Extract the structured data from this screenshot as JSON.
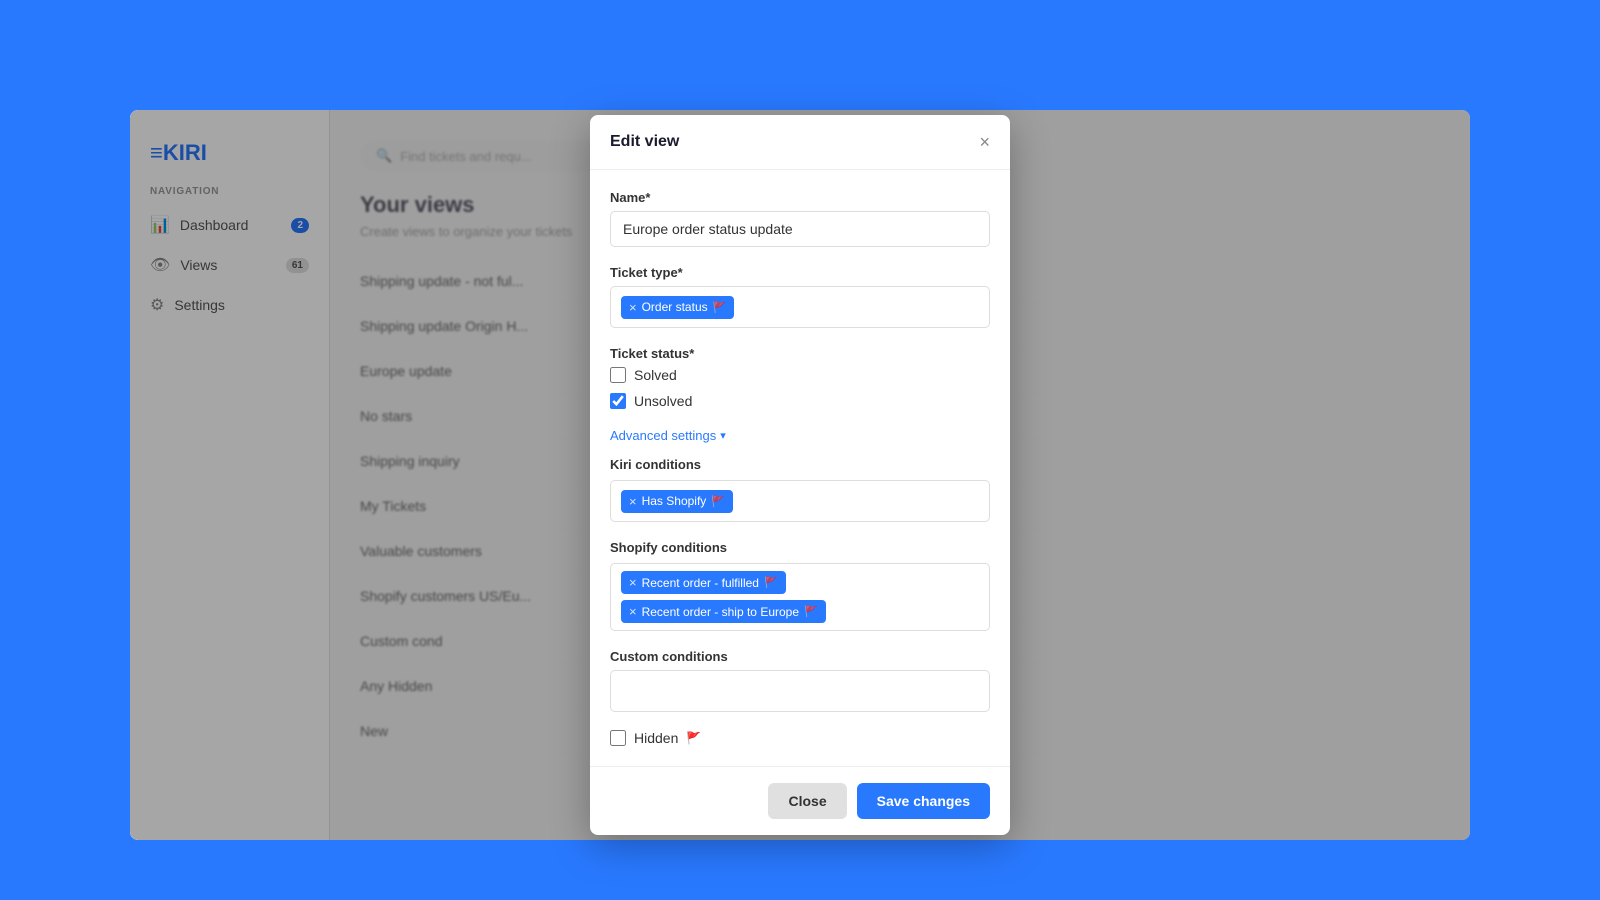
{
  "app": {
    "logo": "≡KIRI",
    "background_color": "#2979FF"
  },
  "sidebar": {
    "nav_label": "Navigation",
    "items": [
      {
        "id": "dashboard",
        "label": "Dashboard",
        "icon": "📊",
        "badge": "2",
        "badge_type": "blue"
      },
      {
        "id": "views",
        "label": "Views",
        "icon": "👁",
        "badge": "61",
        "badge_type": "gray"
      },
      {
        "id": "settings",
        "label": "Settings",
        "icon": "⚙",
        "badge": null
      }
    ]
  },
  "main": {
    "title": "Your views",
    "subtitle": "Create views to organize your tickets",
    "search_placeholder": "Find tickets and requ...",
    "views": [
      "Shipping update - not ful...",
      "Shipping update Origin H...",
      "Europe update",
      "No stars",
      "Shipping inquiry",
      "My Tickets",
      "Valuable customers",
      "Shopify customers US/Eu...",
      "Custom cond",
      "Any  Hidden",
      "New"
    ]
  },
  "modal": {
    "title": "Edit view",
    "close_label": "×",
    "name_label": "Name*",
    "name_value": "Europe order status update",
    "ticket_type_label": "Ticket type*",
    "ticket_type_tag": "Order status",
    "ticket_status_label": "Ticket status*",
    "solved_label": "Solved",
    "solved_checked": false,
    "unsolved_label": "Unsolved",
    "unsolved_checked": true,
    "advanced_settings_label": "Advanced settings",
    "advanced_settings_open": true,
    "kiri_conditions_label": "Kiri conditions",
    "kiri_tag": "Has Shopify",
    "shopify_conditions_label": "Shopify conditions",
    "shopify_tag1": "Recent order - fulfilled",
    "shopify_tag2": "Recent order - ship to Europe",
    "custom_conditions_label": "Custom conditions",
    "custom_conditions_value": "",
    "hidden_label": "Hidden",
    "hidden_checked": false,
    "close_button": "Close",
    "save_button": "Save changes"
  }
}
